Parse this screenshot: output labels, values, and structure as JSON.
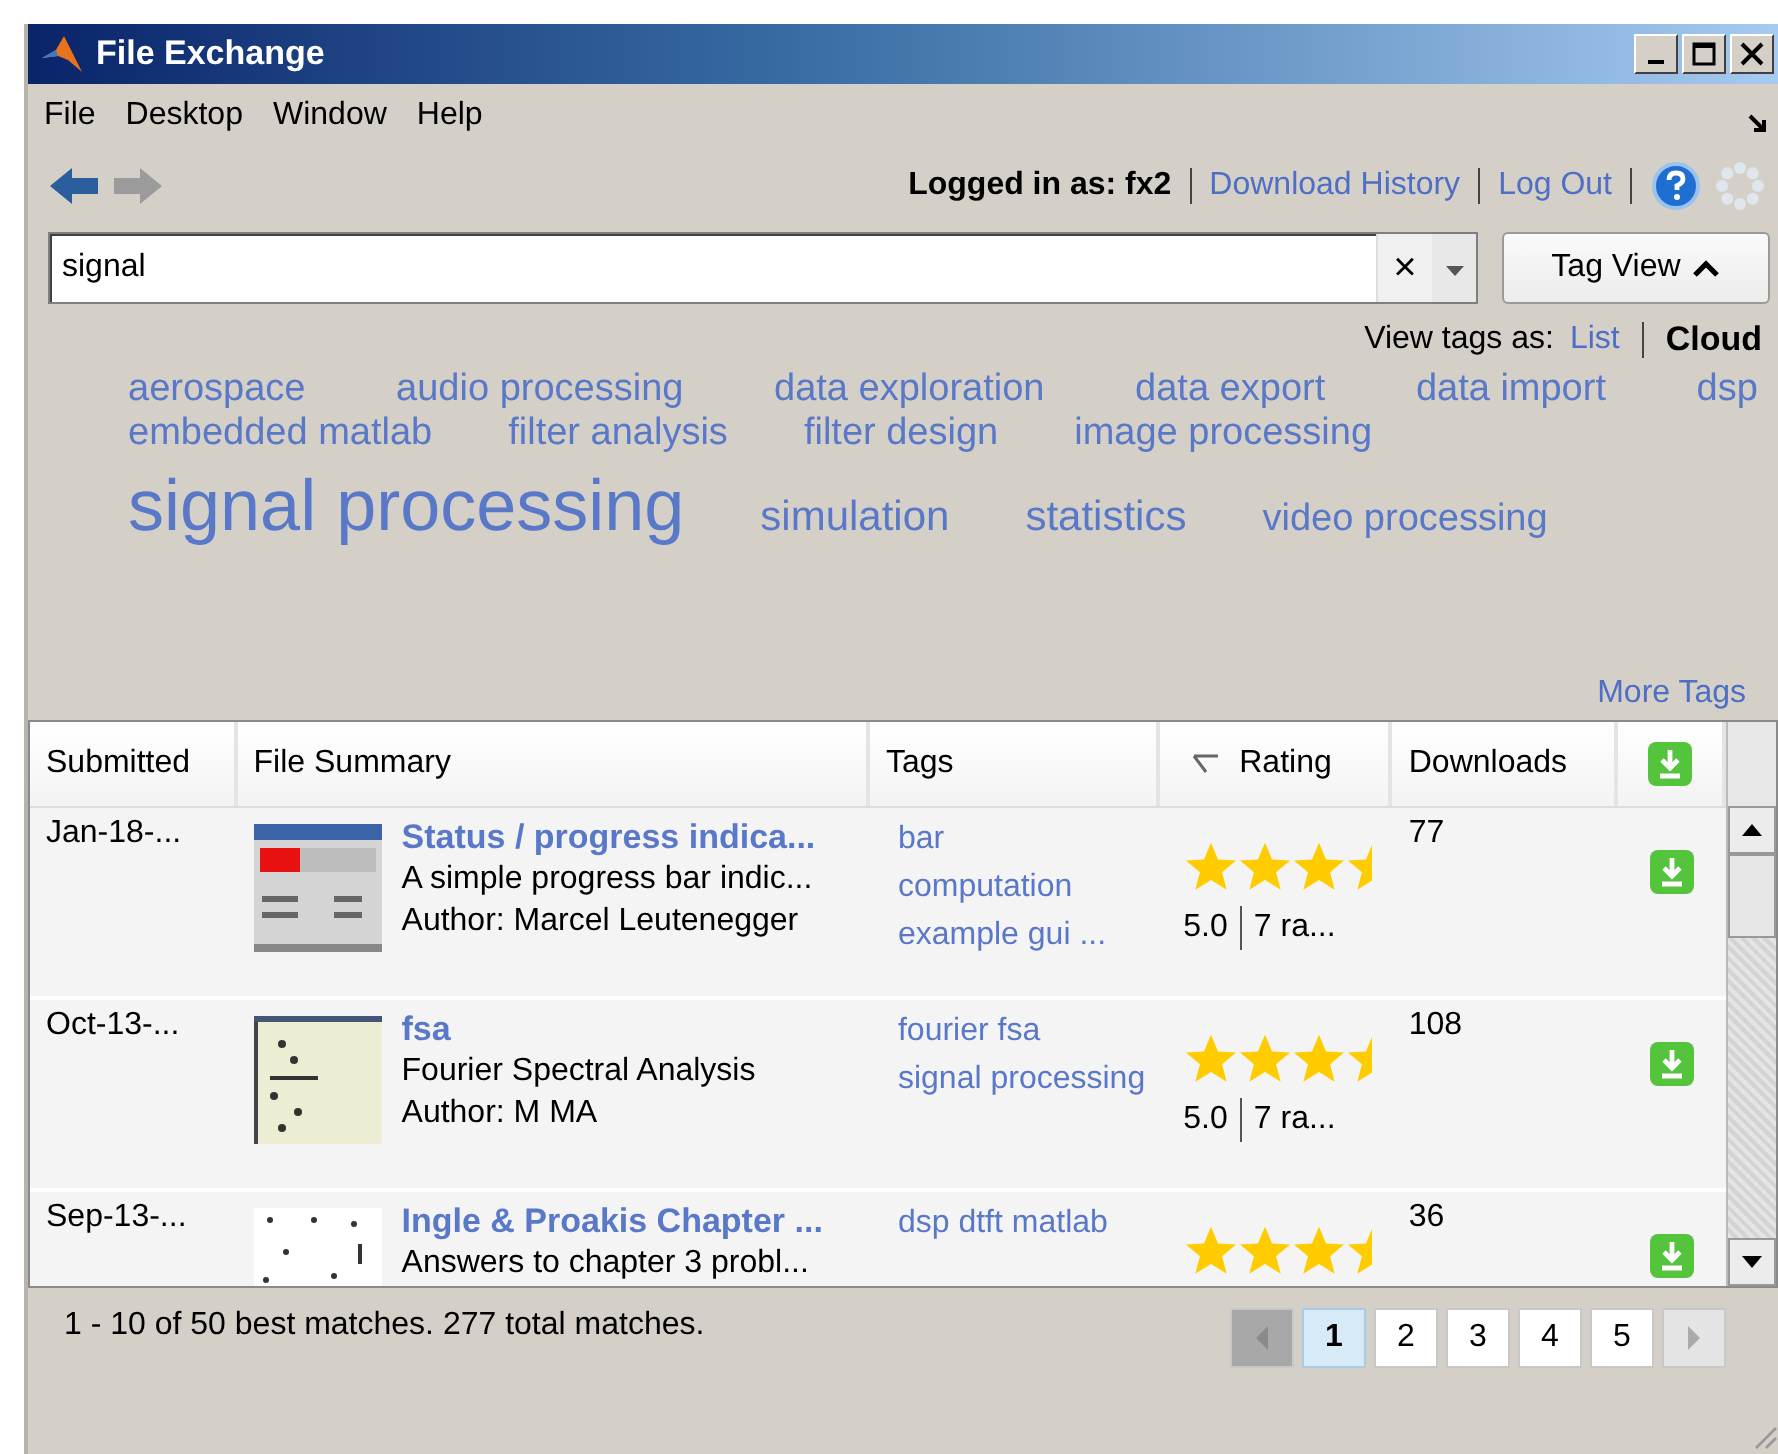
{
  "window": {
    "title": "File Exchange"
  },
  "menu": [
    "File",
    "Desktop",
    "Window",
    "Help"
  ],
  "account": {
    "logged_in": "Logged in as: fx2",
    "links": [
      "Download History",
      "Log Out"
    ]
  },
  "search": {
    "value": "signal",
    "clear": "×"
  },
  "tag_view_button": "Tag View",
  "view_tags": {
    "label": "View tags as:",
    "options": [
      {
        "label": "List",
        "selected": false
      },
      {
        "label": "Cloud",
        "selected": true
      }
    ]
  },
  "tag_cloud": [
    [
      {
        "label": "aerospace",
        "kind": "small"
      },
      {
        "label": "audio processing",
        "kind": "small"
      },
      {
        "label": "data exploration",
        "kind": "small"
      },
      {
        "label": "data export",
        "kind": "small"
      },
      {
        "label": "data import",
        "kind": "small"
      },
      {
        "label": "dsp",
        "kind": "small"
      }
    ],
    [
      {
        "label": "embedded matlab",
        "kind": "small"
      },
      {
        "label": "filter analysis",
        "kind": "small"
      },
      {
        "label": "filter design",
        "kind": "small"
      },
      {
        "label": "image processing",
        "kind": "small"
      }
    ],
    [
      {
        "label": "signal processing",
        "kind": "large"
      },
      {
        "label": "simulation",
        "kind": "medium"
      },
      {
        "label": "statistics",
        "kind": "medium"
      },
      {
        "label": "video processing",
        "kind": "small"
      }
    ]
  ],
  "more_tags": "More Tags",
  "table": {
    "columns": [
      "Submitted",
      "File Summary",
      "Tags",
      "Rating",
      "Downloads"
    ],
    "rows": [
      {
        "submitted": "Jan-18-...",
        "thumbnail": {
          "kind": "picture"
        },
        "title": "Status / progress indica...",
        "summary": "A simple progress bar indic...",
        "author": "Author: Marcel Leutenegger",
        "tags": [
          "bar",
          "computation",
          "example gui ..."
        ],
        "stars": 3.5,
        "rating": "5.0",
        "ratings_count": "7 ra...",
        "downloads": "77"
      },
      {
        "submitted": "Oct-13-...",
        "thumbnail": {
          "kind": "picture"
        },
        "title": "fsa",
        "summary": "Fourier Spectral Analysis",
        "author": "Author: M MA",
        "tags": [
          "fourier fsa",
          "signal processing"
        ],
        "stars": 3.5,
        "rating": "5.0",
        "ratings_count": "7 ra...",
        "downloads": "108"
      },
      {
        "submitted": "Sep-13-...",
        "thumbnail": {
          "kind": "picture"
        },
        "title": "Ingle & Proakis Chapter ...",
        "summary": "Answers to chapter 3 probl...",
        "tags": [
          "dsp dtft matlab"
        ],
        "stars": 3.5,
        "downloads": "36"
      }
    ]
  },
  "status": "1 - 10 of 50 best matches. 277 total matches.",
  "pages": [
    {
      "label": "1",
      "selected": true
    },
    {
      "label": "2",
      "selected": false
    },
    {
      "label": "3",
      "selected": false
    },
    {
      "label": "4",
      "selected": false
    },
    {
      "label": "5",
      "selected": false
    }
  ]
}
